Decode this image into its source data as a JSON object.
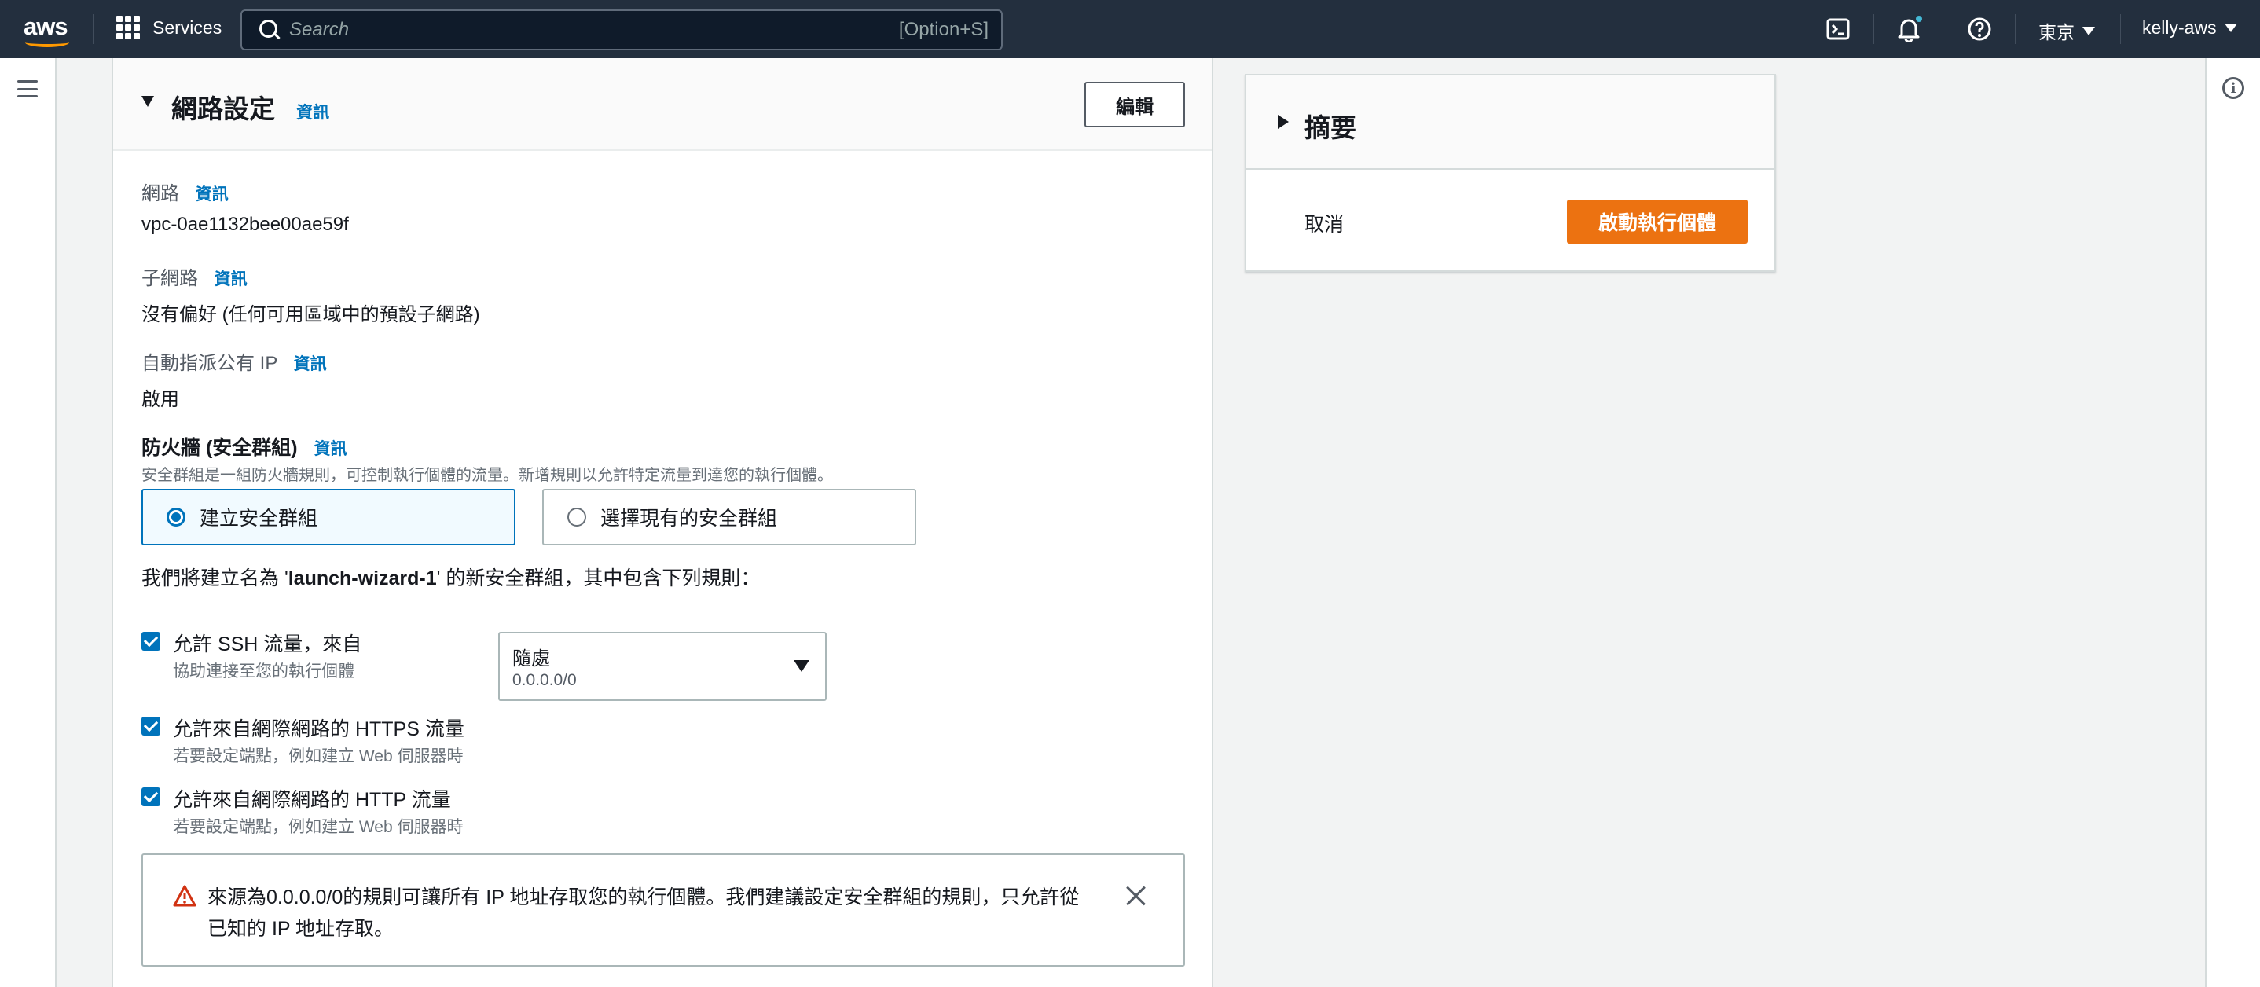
{
  "topnav": {
    "logo_text": "aws",
    "services_label": "Services",
    "search_placeholder": "Search",
    "search_shortcut": "[Option+S]",
    "region_label": "東京",
    "account_label": "kelly-aws"
  },
  "network": {
    "title": "網路設定",
    "info_label": "資訊",
    "edit_label": "編輯",
    "network_label": "網路",
    "network_value": "vpc-0ae1132bee00ae59f",
    "subnet_label": "子網路",
    "subnet_value": "沒有偏好 (任何可用區域中的預設子網路)",
    "public_ip_label": "自動指派公有 IP",
    "public_ip_value": "啟用",
    "firewall_label": "防火牆 (安全群組)",
    "firewall_desc": "安全群組是一組防火牆規則，可控制執行個體的流量。新增規則以允許特定流量到達您的執行個體。",
    "radio_create": "建立安全群組",
    "radio_existing": "選擇現有的安全群組",
    "rule_prefix": "我們將建立名為 '",
    "rule_name": "launch-wizard-1",
    "rule_suffix": "' 的新安全群組，其中包含下列規則：",
    "rules": [
      {
        "label": "允許 SSH 流量，來自",
        "desc": "協助連接至您的執行個體",
        "checked": true
      },
      {
        "label": "允許來自網際網路的 HTTPS 流量",
        "desc": "若要設定端點，例如建立 Web 伺服器時",
        "checked": true
      },
      {
        "label": "允許來自網際網路的 HTTP 流量",
        "desc": "若要設定端點，例如建立 Web 伺服器時",
        "checked": true
      }
    ],
    "ssh_source": {
      "label": "隨處",
      "value": "0.0.0.0/0"
    },
    "warning_text": "來源為0.0.0.0/0的規則可讓所有 IP 地址存取您的執行個體。我們建議設定安全群組的規則，只允許從已知的 IP 地址存取。"
  },
  "summary": {
    "title": "摘要",
    "cancel_label": "取消",
    "launch_label": "啟動執行個體"
  },
  "colors": {
    "nav_bg": "#232f3e",
    "accent_blue": "#0073bb",
    "launch_orange": "#ec7211",
    "warning_red": "#d13212",
    "notification_dot": "#44b9d6"
  },
  "icons": [
    "grid-icon",
    "search-icon",
    "cloudshell-icon",
    "bell-icon",
    "help-icon",
    "hamburger-icon",
    "info-icon",
    "warning-icon",
    "close-icon"
  ]
}
